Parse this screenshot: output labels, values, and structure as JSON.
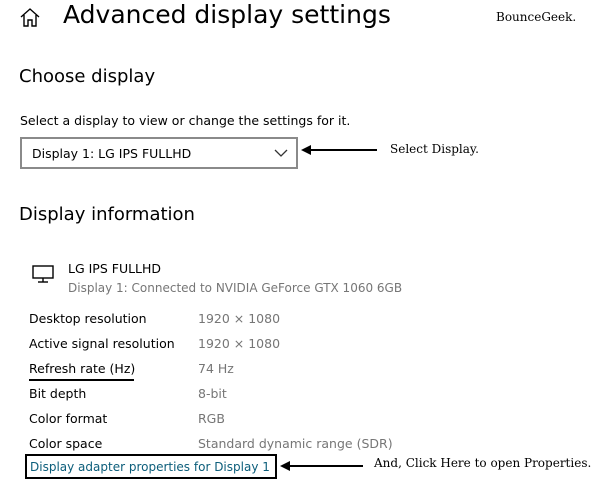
{
  "header": {
    "title": "Advanced display settings",
    "home_icon": "home-icon"
  },
  "watermark": "BounceGeek.",
  "choose_display": {
    "heading": "Choose display",
    "prompt": "Select a display to view or change the settings for it.",
    "dropdown_value": "Display 1: LG IPS FULLHD",
    "annotation": "Select Display."
  },
  "display_info": {
    "heading": "Display information",
    "monitor_icon": "monitor-icon",
    "monitor_name": "LG IPS FULLHD",
    "monitor_subtitle": "Display 1: Connected to NVIDIA GeForce GTX 1060 6GB",
    "rows": [
      {
        "label": "Desktop resolution",
        "value": "1920 × 1080"
      },
      {
        "label": "Active signal resolution",
        "value": "1920 × 1080"
      },
      {
        "label": "Refresh rate (Hz)",
        "value": "74 Hz"
      },
      {
        "label": "Bit depth",
        "value": "8-bit"
      },
      {
        "label": "Color format",
        "value": "RGB"
      },
      {
        "label": "Color space",
        "value": "Standard dynamic range (SDR)"
      }
    ],
    "link_text": "Display adapter properties for Display 1",
    "link_annotation": "And, Click Here to open Properties."
  },
  "colors": {
    "link": "#0b5d7a",
    "secondary_text": "#767676",
    "dropdown_border": "#8a8a8a"
  }
}
